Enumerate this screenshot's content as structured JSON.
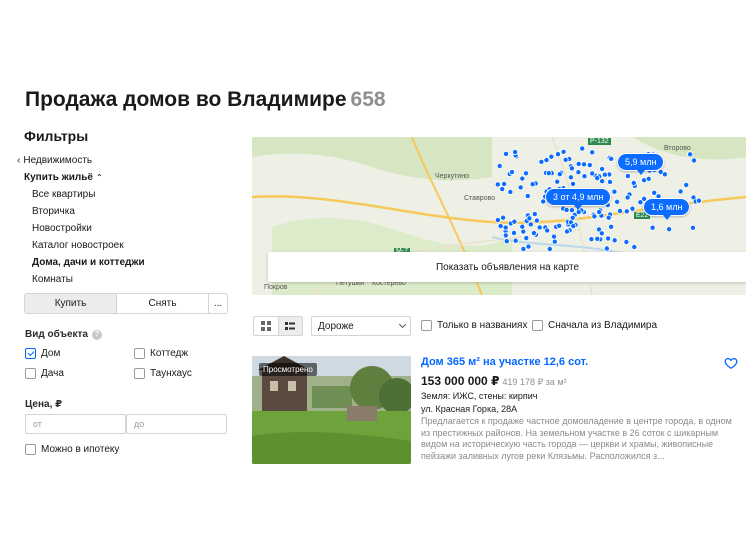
{
  "page": {
    "title": "Продажа домов во Владимире",
    "count": "658"
  },
  "sidebar": {
    "filters_title": "Фильтры",
    "back_label": "Недвижимость",
    "parent_label": "Купить жильё",
    "items": [
      {
        "label": "Все квартиры",
        "active": false
      },
      {
        "label": "Вторичка",
        "active": false
      },
      {
        "label": "Новостройки",
        "active": false
      },
      {
        "label": "Каталог новостроек",
        "active": false
      },
      {
        "label": "Дома, дачи и коттеджи",
        "active": true
      },
      {
        "label": "Комнаты",
        "active": false
      }
    ],
    "deal_buy": "Купить",
    "deal_rent": "Снять",
    "deal_more": "...",
    "object_type_label": "Вид объекта",
    "object_types": [
      {
        "label": "Дом",
        "checked": true
      },
      {
        "label": "Коттедж",
        "checked": false
      },
      {
        "label": "Дача",
        "checked": false
      },
      {
        "label": "Таунхаус",
        "checked": false
      }
    ],
    "price_label": "Цена, ₽",
    "price_from_placeholder": "от",
    "price_to_placeholder": "до",
    "mortgage_label": "Можно в ипотеку"
  },
  "map": {
    "places": [
      "Черкутино",
      "Ставрово",
      "Второво",
      "Покров",
      "Петушки",
      "Костерево",
      "Р-132",
      "E22",
      "M-7"
    ],
    "clusters": [
      "5,9 млн",
      "3 от 4,9 млн",
      "1,6 млн"
    ],
    "show_button": "Показать объявления на карте",
    "colors": {
      "cluster": "#0b6cff",
      "road": "#f6c95a",
      "water": "#b9d7ee",
      "forest": "#d6e6c2"
    }
  },
  "toolbar": {
    "sort_value": "Дороже",
    "only_titles": "Только в названиях",
    "vladimir_first": "Сначала из Владимира"
  },
  "listing": {
    "badge": "Просмотрено",
    "title": "Дом 365 м² на участке 12,6 сот.",
    "price": "153 000 000 ₽",
    "price_per_m2": "419 178 ₽ за м²",
    "params": "Земля: ИЖС, стены: кирпич",
    "address": "ул. Красная Горка, 28А",
    "description": "Предлагается к продаже частное домовладение в центре города, в одном из престижных районов. На земельном участке в 26 соток с шикарным видом на историческую часть города — церкви и храмы, живописные пейзажи заливных лугов реки Клязьмы. Расположился з..."
  }
}
